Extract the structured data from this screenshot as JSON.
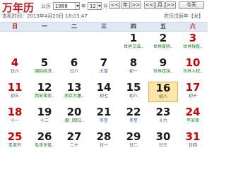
{
  "app": {
    "title": "万年历"
  },
  "controls": {
    "era_label": "公历",
    "year_value": "1988",
    "year_suffix": "年",
    "month_value": "12",
    "month_suffix": "月",
    "nav": [
      "<<",
      "年",
      ">>",
      "<<",
      "月",
      ">>",
      "今天"
    ]
  },
  "subheader": {
    "time_text": "本机时间：2013年4月20日 18:03:47",
    "lunar_text": "农历戊辰年【龙】"
  },
  "weekdays": [
    "日",
    "一",
    "二",
    "三",
    "四",
    "五",
    "六"
  ],
  "weeks": [
    [
      {
        "day": "",
        "sub": ""
      },
      {
        "day": "",
        "sub": ""
      },
      {
        "day": "",
        "sub": ""
      },
      {
        "day": "",
        "sub": ""
      },
      {
        "day": "1",
        "sub": "世界艾滋..",
        "kind": "fest"
      },
      {
        "day": "2",
        "sub": "世界废除..",
        "kind": "fest"
      },
      {
        "day": "3",
        "sub": "世界残疾..",
        "kind": "fest"
      }
    ],
    [
      {
        "day": "4",
        "sub": "廿六",
        "kind": ""
      },
      {
        "day": "5",
        "sub": "国际经济..",
        "kind": "fest"
      },
      {
        "day": "6",
        "sub": "廿八",
        "kind": ""
      },
      {
        "day": "7",
        "sub": "大雪",
        "kind": "term"
      },
      {
        "day": "8",
        "sub": "初一",
        "kind": ""
      },
      {
        "day": "9",
        "sub": "世界足球..",
        "kind": "fest"
      },
      {
        "day": "10",
        "sub": "世界人权..",
        "kind": "fest"
      }
    ],
    [
      {
        "day": "11",
        "sub": "初三",
        "kind": ""
      },
      {
        "day": "12",
        "sub": "西安事变..",
        "kind": "fest"
      },
      {
        "day": "13",
        "sub": "南京大屠..",
        "kind": "fest"
      },
      {
        "day": "14",
        "sub": "初七",
        "kind": ""
      },
      {
        "day": "15",
        "sub": "初八",
        "kind": ""
      },
      {
        "day": "16",
        "sub": "初八",
        "kind": "",
        "today": true
      },
      {
        "day": "17",
        "sub": "初十",
        "kind": ""
      }
    ],
    [
      {
        "day": "18",
        "sub": "十一",
        "kind": ""
      },
      {
        "day": "19",
        "sub": "十二",
        "kind": ""
      },
      {
        "day": "20",
        "sub": "澳门回归..",
        "kind": "fest"
      },
      {
        "day": "21",
        "sub": "冬至",
        "kind": "term"
      },
      {
        "day": "22",
        "sub": "冬至",
        "kind": "term"
      },
      {
        "day": "23",
        "sub": "十六",
        "kind": ""
      },
      {
        "day": "24",
        "sub": "平安夜",
        "kind": "fest"
      }
    ],
    [
      {
        "day": "25",
        "sub": "圣诞节",
        "kind": "fest"
      },
      {
        "day": "26",
        "sub": "毛泽东诞..",
        "kind": "fest"
      },
      {
        "day": "27",
        "sub": "二十",
        "kind": ""
      },
      {
        "day": "28",
        "sub": "廿一",
        "kind": ""
      },
      {
        "day": "29",
        "sub": "廿二",
        "kind": ""
      },
      {
        "day": "30",
        "sub": "廿三",
        "kind": ""
      },
      {
        "day": "31",
        "sub": "廿四",
        "kind": ""
      }
    ]
  ]
}
